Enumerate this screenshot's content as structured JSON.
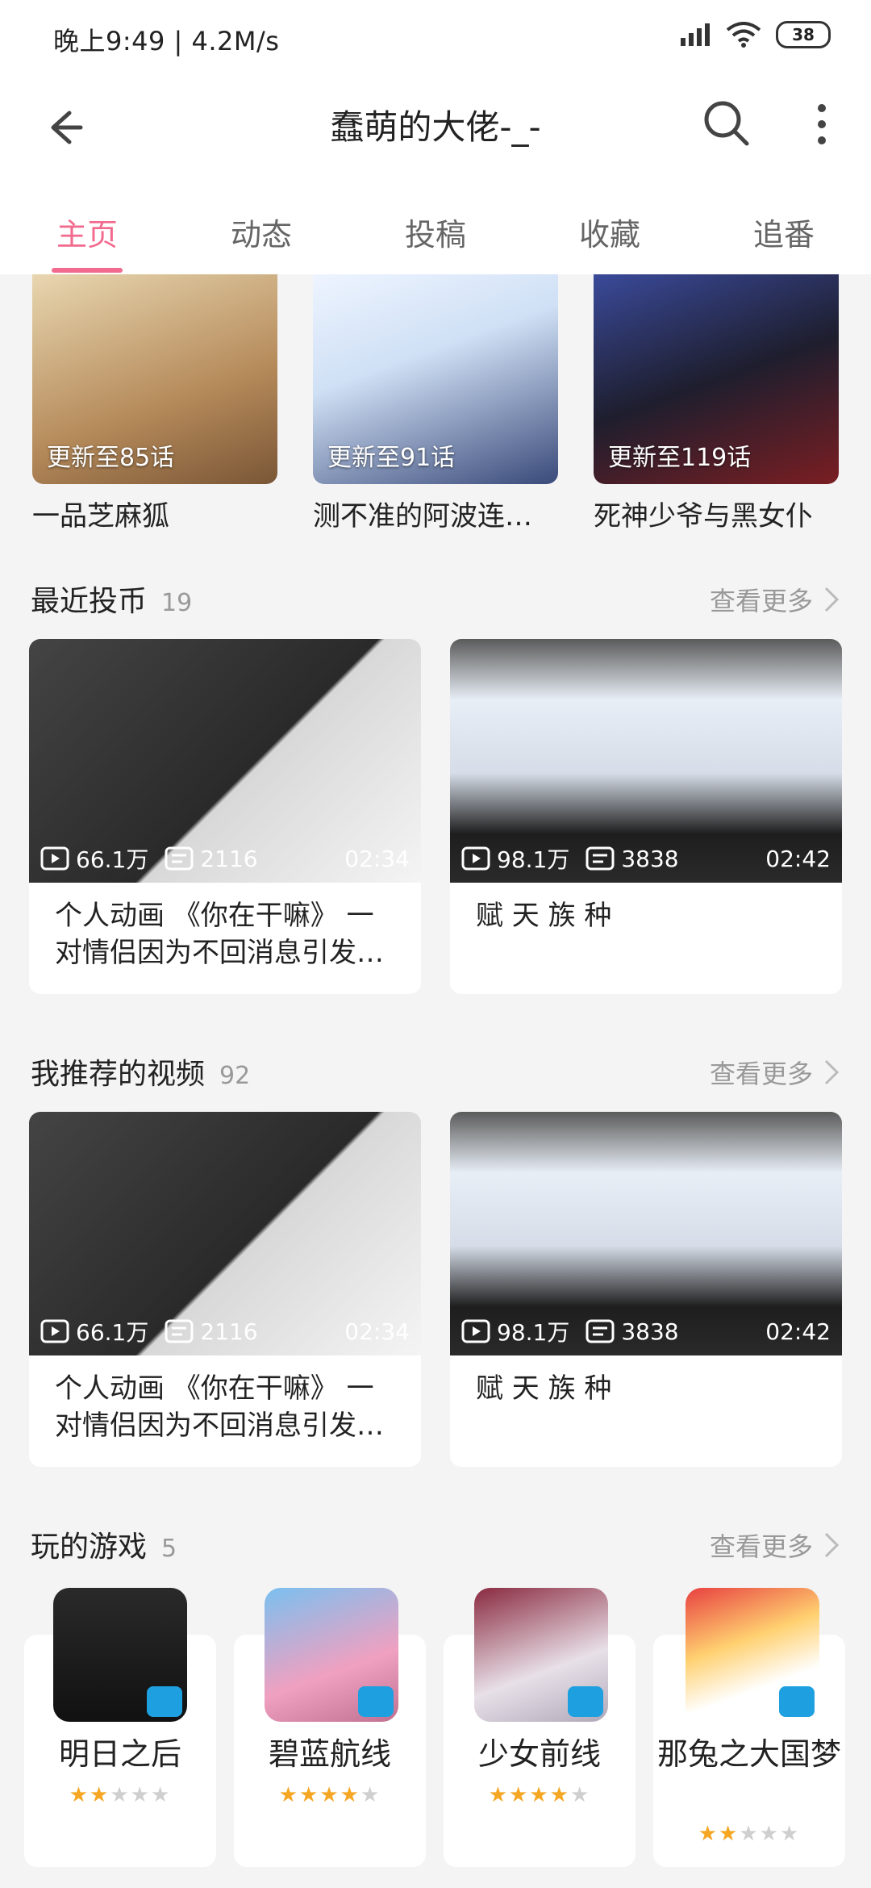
{
  "status": {
    "time_speed": "晚上9:49 | 4.2M/s",
    "battery": "38"
  },
  "header": {
    "title": "蠢萌的大佬-_-"
  },
  "tabs": [
    "主页",
    "动态",
    "投稿",
    "收藏",
    "追番"
  ],
  "manga": [
    {
      "update": "更新至85话",
      "title": "一品芝麻狐"
    },
    {
      "update": "更新至91话",
      "title": "测不准的阿波连…"
    },
    {
      "update": "更新至119话",
      "title": "死神少爷与黑女仆"
    }
  ],
  "coins": {
    "title": "最近投币",
    "count": "19",
    "more": "查看更多",
    "videos": [
      {
        "views": "66.1万",
        "danmaku": "2116",
        "duration": "02:34",
        "title": "个人动画 《你在干嘛》 一对情侣因为不回消息引发…"
      },
      {
        "views": "98.1万",
        "danmaku": "3838",
        "duration": "02:42",
        "title": "赋 天 族 种"
      }
    ]
  },
  "recommended": {
    "title": "我推荐的视频",
    "count": "92",
    "more": "查看更多",
    "videos": [
      {
        "views": "66.1万",
        "danmaku": "2116",
        "duration": "02:34",
        "title": "个人动画 《你在干嘛》 一对情侣因为不回消息引发…"
      },
      {
        "views": "98.1万",
        "danmaku": "3838",
        "duration": "02:42",
        "title": "赋 天 族 种"
      }
    ]
  },
  "games": {
    "title": "玩的游戏",
    "count": "5",
    "more": "查看更多",
    "items": [
      {
        "name": "明日之后",
        "stars": 1.5
      },
      {
        "name": "碧蓝航线",
        "stars": 4
      },
      {
        "name": "少女前线",
        "stars": 4
      },
      {
        "name": "那兔之大国梦",
        "stars": 2
      }
    ]
  },
  "colors": {
    "accent": "#f26a8d",
    "star": "#f5a623",
    "badge": "#1ea0e0"
  }
}
